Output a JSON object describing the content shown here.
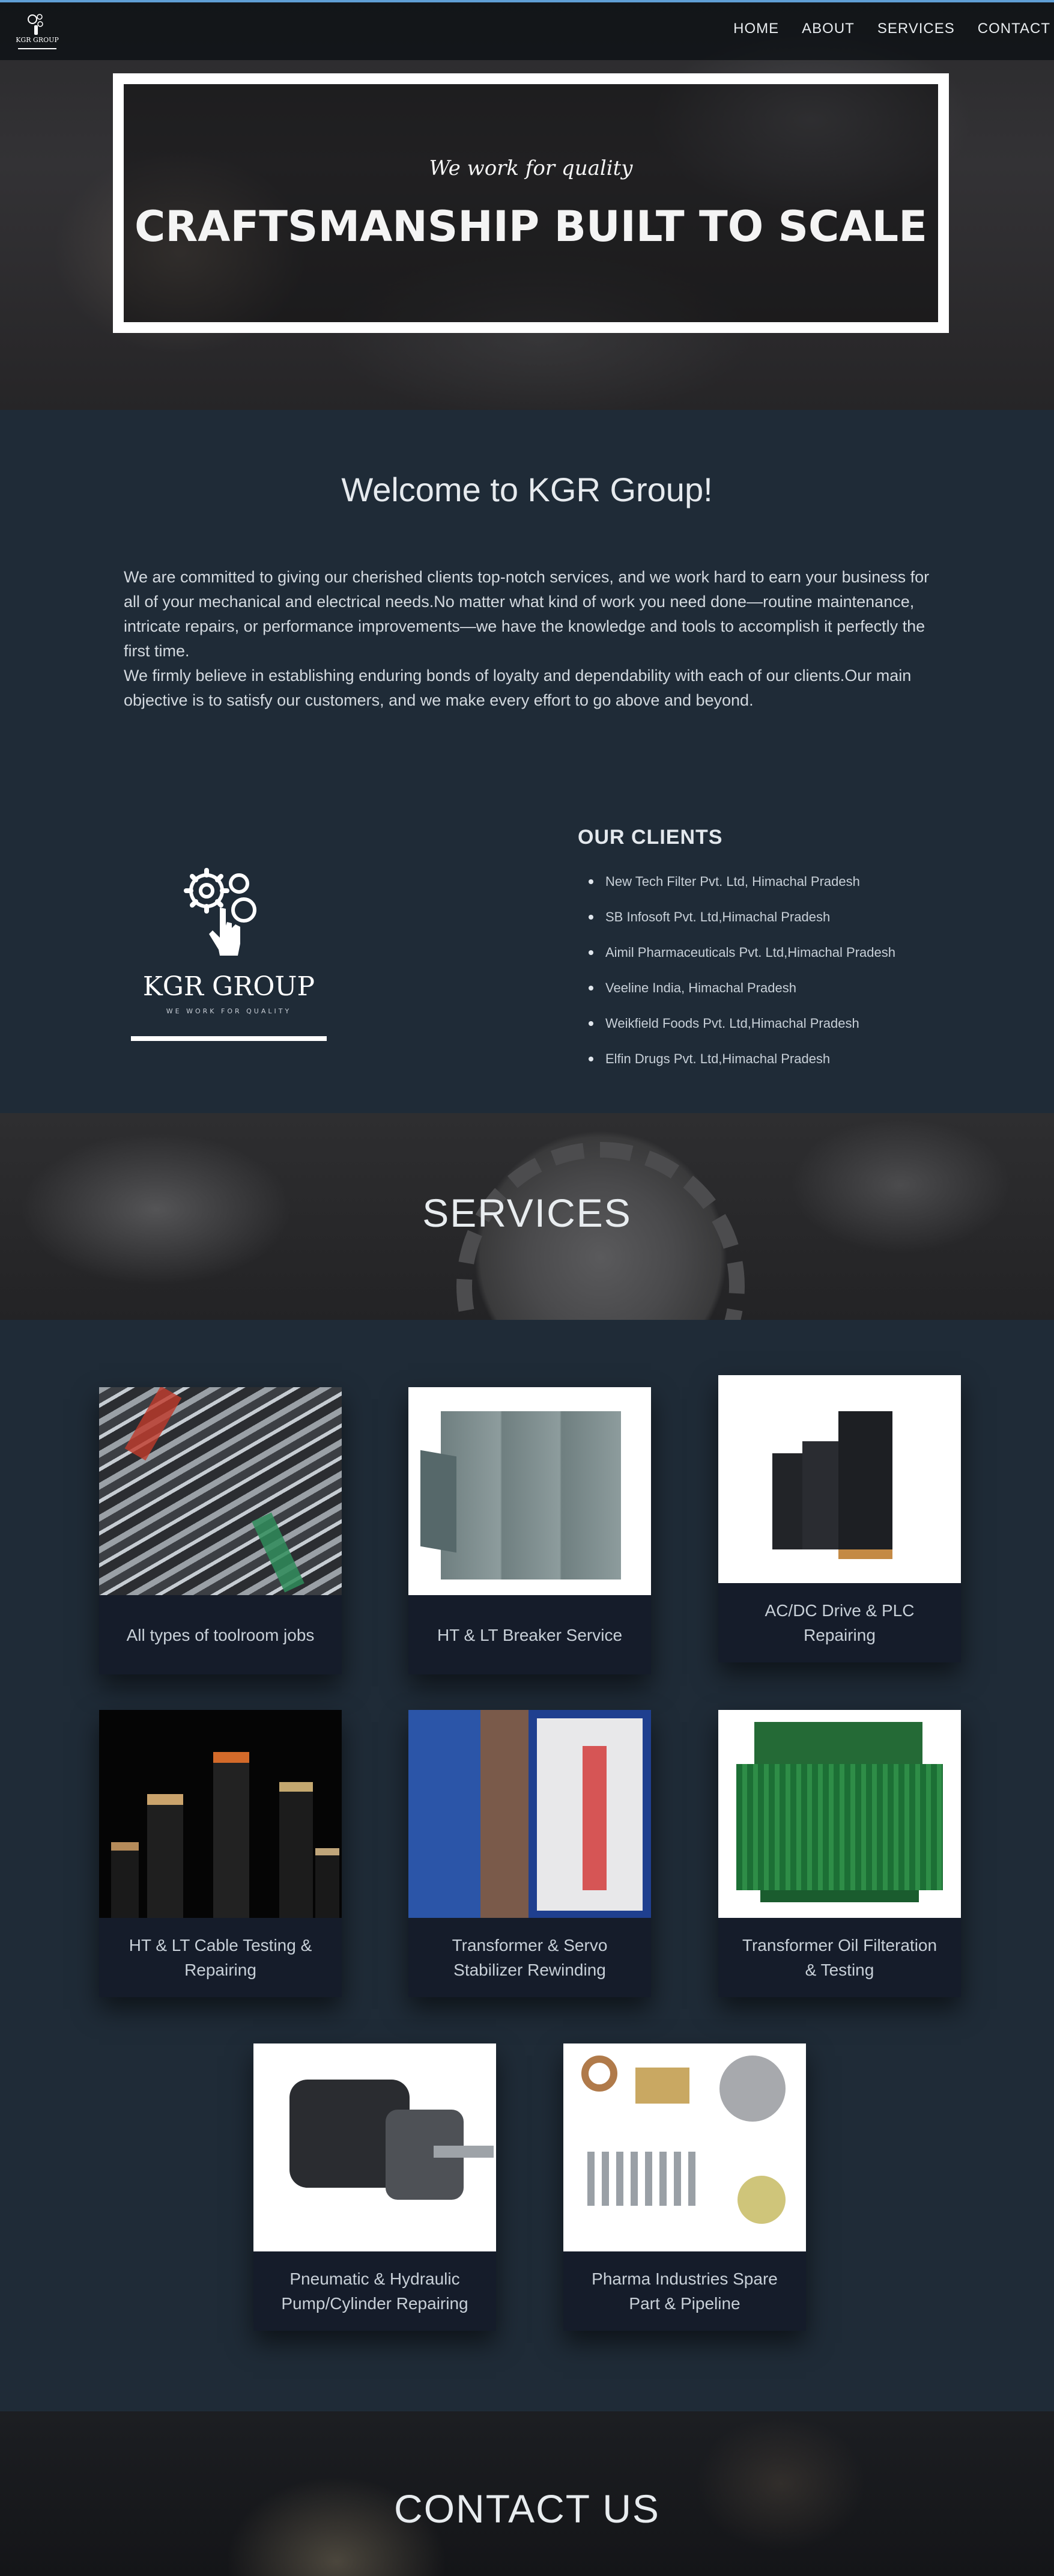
{
  "nav": {
    "links": [
      "HOME",
      "ABOUT",
      "SERVICES",
      "CONTACT"
    ]
  },
  "hero": {
    "tagline": "We work for quality",
    "title": "CRAFTSMANSHIP BUILT TO SCALE"
  },
  "welcome": {
    "title": "Welcome to KGR Group!",
    "paragraphs": [
      "We are committed to giving our cherished clients top-notch services, and we work hard to earn your business for all of your mechanical and electrical needs.No matter what kind of work you need done—routine maintenance, intricate repairs, or performance improvements—we have the knowledge and tools to accomplish it perfectly the first time.",
      "We firmly believe in establishing enduring bonds of loyalty and dependability with each of our clients.Our main objective is to satisfy our customers, and we make every effort to go above and beyond."
    ]
  },
  "brand": {
    "name": "KGR GROUP",
    "slogan": "WE WORK FOR QUALITY"
  },
  "clients": {
    "title": "OUR CLIENTS",
    "items": [
      "New Tech Filter Pvt. Ltd, Himachal Pradesh",
      "SB Infosoft Pvt. Ltd,Himachal Pradesh",
      "Aimil Pharmaceuticals Pvt. Ltd,Himachal Pradesh",
      "Veeline India, Himachal Pradesh",
      "Weikfield Foods Pvt. Ltd,Himachal Pradesh",
      "Elfin Drugs Pvt. Ltd,Himachal Pradesh"
    ]
  },
  "services": {
    "title": "SERVICES",
    "cards": [
      {
        "label": "All types of toolroom jobs",
        "icon": "tools-image"
      },
      {
        "label": "HT & LT Breaker Service",
        "icon": "breaker-panel-image"
      },
      {
        "label": "AC/DC Drive & PLC Repairing",
        "icon": "drive-unit-image"
      },
      {
        "label": "HT & LT Cable Testing & Repairing",
        "icon": "cable-image"
      },
      {
        "label": "Transformer & Servo Stabilizer Rewinding",
        "icon": "stabilizer-image"
      },
      {
        "label": "Transformer Oil Filteration & Testing",
        "icon": "transformer-image"
      },
      {
        "label": "Pneumatic & Hydraulic Pump/Cylinder Repairing",
        "icon": "pump-image"
      },
      {
        "label": "Pharma Industries Spare Part & Pipeline",
        "icon": "spare-parts-image"
      }
    ]
  },
  "contact": {
    "title": "CONTACT US"
  },
  "colors": {
    "page_bg": "#1f2b37",
    "card_bg": "#151c2a",
    "nav_accent": "#5f9fd6"
  }
}
